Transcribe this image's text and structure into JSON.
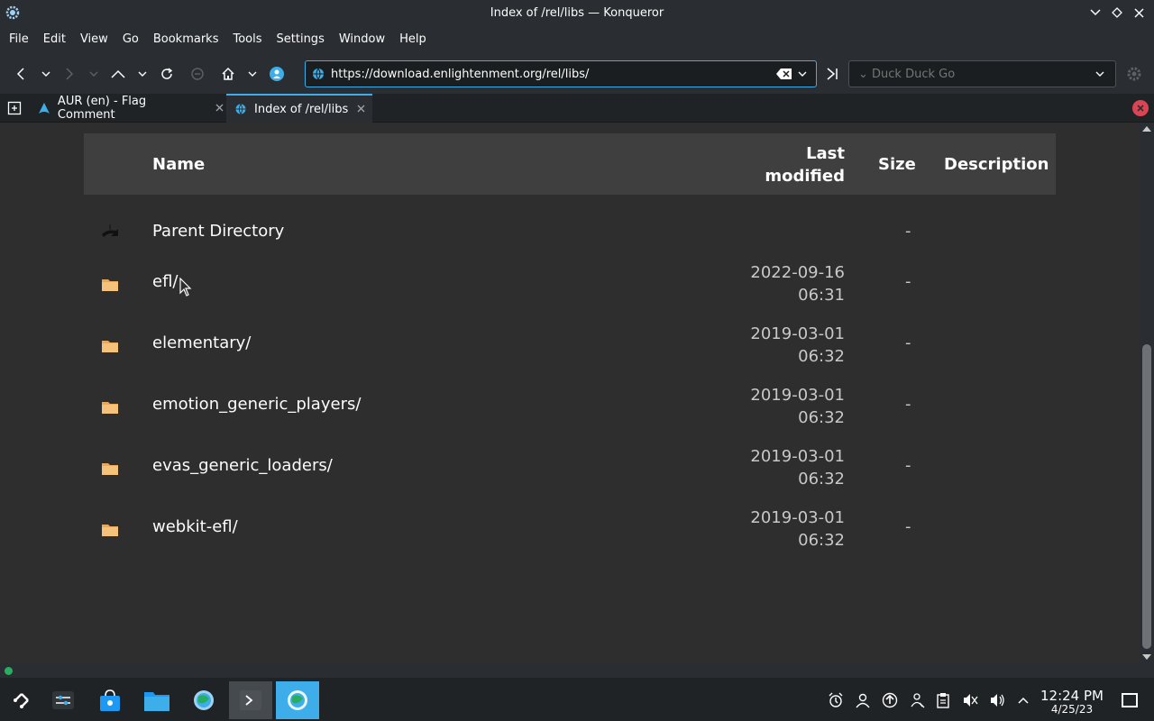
{
  "window": {
    "title": "Index of /rel/libs — Konqueror",
    "controls": [
      "chevron-down-icon",
      "diamond-icon",
      "close-icon"
    ]
  },
  "menubar": {
    "items": [
      "File",
      "Edit",
      "View",
      "Go",
      "Bookmarks",
      "Tools",
      "Settings",
      "Window",
      "Help"
    ]
  },
  "toolbar": {
    "url": "https://download.enlightenment.org/rel/libs/",
    "search_placeholder": "⌄ Duck Duck Go"
  },
  "tabs": [
    {
      "label": "AUR (en) - Flag Comment",
      "active": false
    },
    {
      "label": "Index of /rel/libs",
      "active": true
    }
  ],
  "listing": {
    "headers": {
      "name": "Name",
      "modified_line1": "Last",
      "modified_line2": "modified",
      "size": "Size",
      "description": "Description"
    },
    "rows": [
      {
        "name": "Parent Directory",
        "date": "",
        "time": "",
        "size": "-",
        "icon": "back-arrow-icon"
      },
      {
        "name": "efl/",
        "date": "2022-09-16",
        "time": "06:31",
        "size": "-",
        "icon": "folder-icon"
      },
      {
        "name": "elementary/",
        "date": "2019-03-01",
        "time": "06:32",
        "size": "-",
        "icon": "folder-icon"
      },
      {
        "name": "emotion_generic_players/",
        "date": "2019-03-01",
        "time": "06:32",
        "size": "-",
        "icon": "folder-icon"
      },
      {
        "name": "evas_generic_loaders/",
        "date": "2019-03-01",
        "time": "06:32",
        "size": "-",
        "icon": "folder-icon"
      },
      {
        "name": "webkit-efl/",
        "date": "2019-03-01",
        "time": "06:32",
        "size": "-",
        "icon": "folder-icon"
      }
    ]
  },
  "taskbar": {
    "clock_time": "12:24 PM",
    "clock_date": "4/25/23"
  },
  "colors": {
    "accent": "#3daee9",
    "window_bg": "#2a2e32",
    "page_bg": "#2e2e2e",
    "header_bg": "#3f3f3f",
    "folder": "#f5c27b"
  }
}
